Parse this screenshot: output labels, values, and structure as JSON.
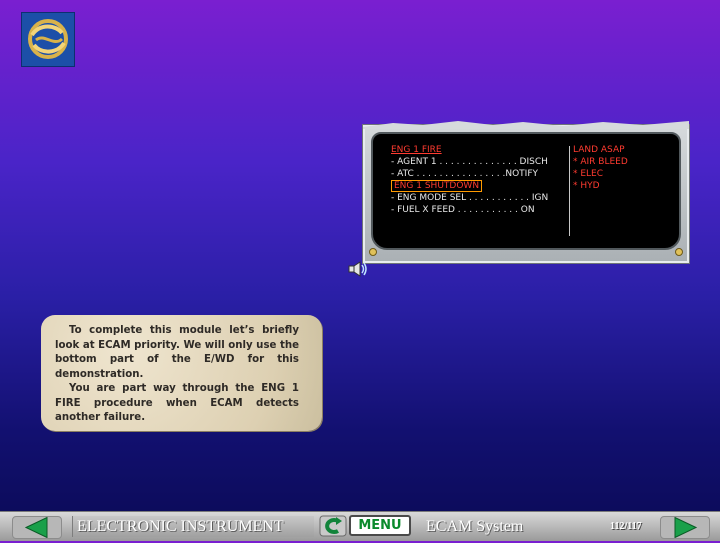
{
  "ecam": {
    "left_lines": [
      {
        "text": "ENG 1 FIRE",
        "color": "red",
        "style": "underline"
      },
      {
        "text": "- AGENT 1 . . . . . . . . . . . . . . DISCH",
        "color": "white"
      },
      {
        "text": "- ATC  . . . . . . . . . . . . . . . .NOTIFY",
        "color": "white"
      },
      {
        "text": "ENG 1 SHUTDOWN",
        "color": "red",
        "style": "boxed"
      },
      {
        "text": "- ENG MODE SEL . . . . . . . . . . . IGN",
        "color": "white"
      },
      {
        "text": "- FUEL X FEED  . . . . . . . . . . . ON",
        "color": "white"
      }
    ],
    "right_lines": [
      {
        "text": "LAND ASAP",
        "color": "red"
      },
      {
        "text": "* AIR BLEED",
        "color": "red"
      },
      {
        "text": "* ELEC",
        "color": "red"
      },
      {
        "text": "* HYD",
        "color": "red"
      }
    ]
  },
  "note": {
    "paragraph1": "To complete this module let’s briefly look at ECAM priority. We will only use the bottom part of the E/WD for this demonstration.",
    "paragraph2": "You are part way through the ENG 1 FIRE procedure when ECAM detects another failure."
  },
  "footer": {
    "module_title": "ELECTRONIC INSTRUMENT",
    "menu_label": "MENU",
    "section_title": "ECAM System",
    "page_counter": "112/117"
  },
  "icons": {
    "logo": "company-logo",
    "speaker": "speaker-icon",
    "back": "left-arrow-icon",
    "forward": "right-arrow-icon",
    "contents": "c-return-icon"
  }
}
